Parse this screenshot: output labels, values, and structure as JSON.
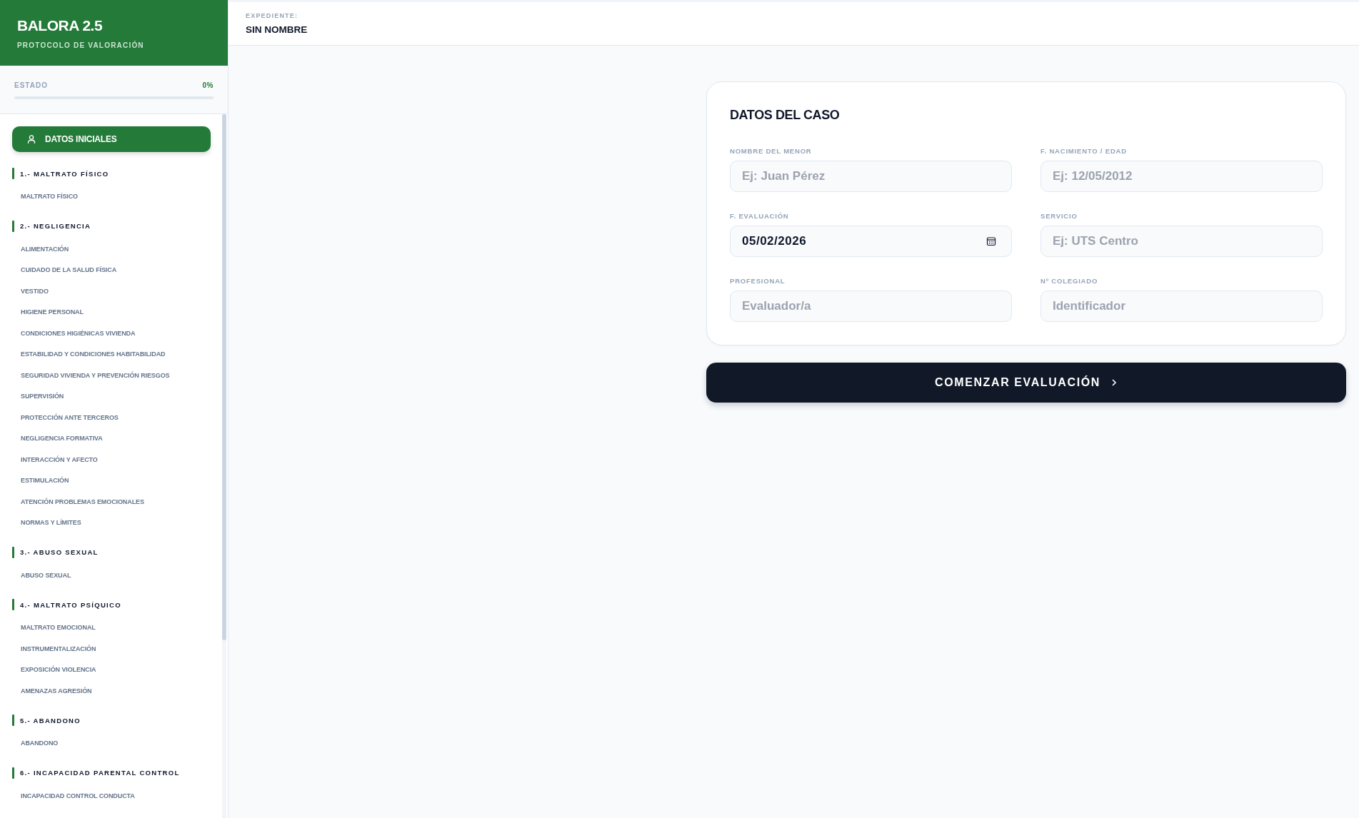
{
  "sidebar": {
    "app_title": "BALORA 2.5",
    "app_subtitle": "PROTOCOLO DE VALORACIÓN",
    "status": {
      "label": "ESTADO",
      "reading": "0%",
      "level": 0
    },
    "nav": {
      "start_item": {
        "label": "DATOS INICIALES",
        "selected": true
      },
      "groups": [
        {
          "title": "1.- MALTRATO FÍSICO",
          "items": [
            {
              "label": "MALTRATO FÍSICO",
              "selected": false
            }
          ]
        },
        {
          "title": "2.- NEGLIGENCIA",
          "items": [
            {
              "label": "ALIMENTACIÓN",
              "selected": false
            },
            {
              "label": "CUIDADO DE LA SALUD FÍSICA",
              "selected": false
            },
            {
              "label": "VESTIDO",
              "selected": false
            },
            {
              "label": "HIGIENE PERSONAL",
              "selected": false
            },
            {
              "label": "CONDICIONES HIGIÉNICAS VIVIENDA",
              "selected": false
            },
            {
              "label": "ESTABILIDAD Y CONDICIONES HABITABILIDAD",
              "selected": false
            },
            {
              "label": "SEGURIDAD VIVIENDA Y PREVENCIÓN RIESGOS",
              "selected": false
            },
            {
              "label": "SUPERVISIÓN",
              "selected": false
            },
            {
              "label": "PROTECCIÓN ANTE TERCEROS",
              "selected": false
            },
            {
              "label": "NEGLIGENCIA FORMATIVA",
              "selected": false
            },
            {
              "label": "INTERACCIÓN Y AFECTO",
              "selected": false
            },
            {
              "label": "ESTIMULACIÓN",
              "selected": false
            },
            {
              "label": "ATENCIÓN PROBLEMAS EMOCIONALES",
              "selected": false
            },
            {
              "label": "NORMAS Y LÍMITES",
              "selected": false
            }
          ]
        },
        {
          "title": "3.- ABUSO SEXUAL",
          "items": [
            {
              "label": "ABUSO SEXUAL",
              "selected": false
            }
          ]
        },
        {
          "title": "4.- MALTRATO PSÍQUICO",
          "items": [
            {
              "label": "MALTRATO EMOCIONAL",
              "selected": false
            },
            {
              "label": "INSTRUMENTALIZACIÓN",
              "selected": false
            },
            {
              "label": "EXPOSICIÓN VIOLENCIA",
              "selected": false
            },
            {
              "label": "AMENAZAS AGRESIÓN",
              "selected": false
            }
          ]
        },
        {
          "title": "5.- ABANDONO",
          "items": [
            {
              "label": "ABANDONO",
              "selected": false
            }
          ]
        },
        {
          "title": "6.- INCAPACIDAD PARENTAL CONTROL",
          "items": [
            {
              "label": "INCAPACIDAD CONTROL CONDUCTA",
              "selected": false
            }
          ]
        }
      ]
    }
  },
  "header": {
    "label": "EXPEDIENTE:",
    "value": "SIN NOMBRE"
  },
  "form": {
    "title": "DATOS DEL CASO",
    "fields": [
      {
        "kind": "text",
        "label": "NOMBRE DEL MENOR",
        "placeholder": "Ej: Juan Pérez"
      },
      {
        "kind": "text",
        "label": "F. NACIMIENTO / EDAD",
        "placeholder": "Ej: 12/05/2012"
      },
      {
        "kind": "date",
        "label": "F. EVALUACIÓN",
        "value": "05/02/2026"
      },
      {
        "kind": "text",
        "label": "SERVICIO",
        "placeholder": "Ej: UTS Centro"
      },
      {
        "kind": "text",
        "label": "PROFESIONAL",
        "placeholder": "Evaluador/a"
      },
      {
        "kind": "text",
        "label": "Nº COLEGIADO",
        "placeholder": "Identificador"
      }
    ]
  },
  "submit": {
    "label": "COMENZAR EVALUACIÓN"
  }
}
